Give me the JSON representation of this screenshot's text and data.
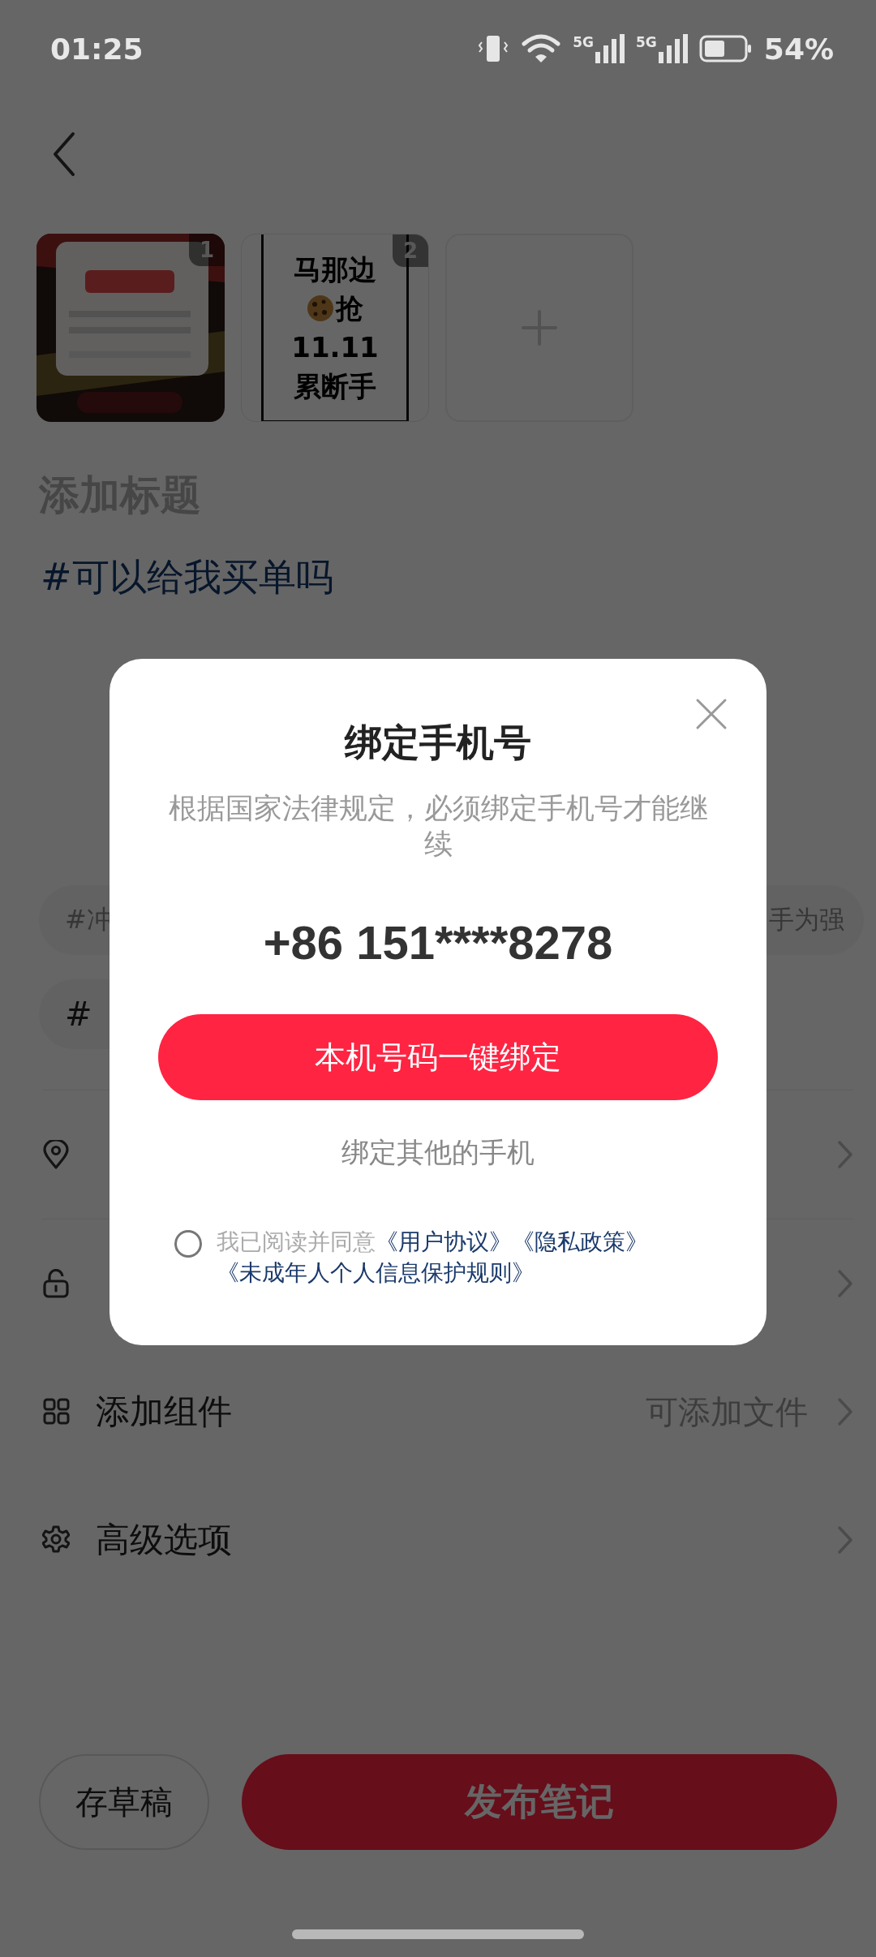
{
  "status_bar": {
    "time": "01:25",
    "signals": [
      "5G",
      "5G"
    ],
    "battery": "54%"
  },
  "images": [
    {
      "kind": "picture",
      "badge": "1"
    },
    {
      "kind": "text_card",
      "badge": "2",
      "lines": [
        {
          "text": "马那边",
          "emoji": false
        },
        {
          "text": "抢",
          "emoji": true
        },
        {
          "text": "11.11",
          "emoji": false
        },
        {
          "text": "累断手",
          "emoji": false
        }
      ]
    },
    {
      "kind": "add"
    }
  ],
  "title_placeholder": "添加标题",
  "body": "#可以给我买单吗",
  "tag_rows": [
    [
      "#冲",
      "手为强"
    ],
    [
      "#"
    ]
  ],
  "menu": [
    {
      "kind": "pin"
    },
    {
      "kind": "lock"
    },
    {
      "kind": "grid",
      "label": "添加组件",
      "value": "可添加文件"
    },
    {
      "kind": "gear",
      "label": "高级选项"
    }
  ],
  "bottom_bar": {
    "draft": "存草稿",
    "publish": "发布笔记"
  },
  "dialog": {
    "title": "绑定手机号",
    "message": "根据国家法律规定，必须绑定手机号才能继续",
    "phone": "+86 151****8278",
    "primary": "本机号码一键绑定",
    "secondary": "绑定其他的手机",
    "agreement": {
      "checked": false,
      "prefix": "我已阅读并同意",
      "links": [
        "《用户协议》",
        "《隐私政策》",
        "《未成年人个人信息保护规则》"
      ]
    }
  }
}
